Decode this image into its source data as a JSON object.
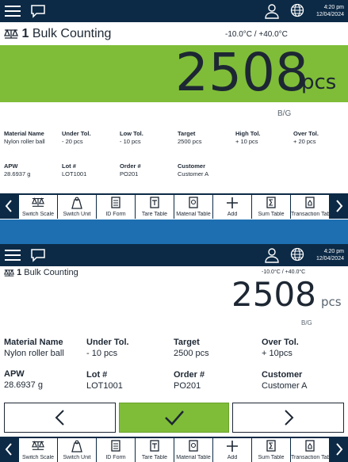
{
  "status": {
    "time": "4:20 pm",
    "date": "12/04/2024"
  },
  "screen1": {
    "scale_no": "1",
    "app_name": "Bulk Counting",
    "range": "-10.0°C / +40.0°C",
    "weight": "2508",
    "unit": "pcs",
    "mode": "B/G",
    "fields": [
      {
        "label": "Material Name",
        "value": "Nylon roller ball"
      },
      {
        "label": "Under Tol.",
        "value": "- 20 pcs"
      },
      {
        "label": "Low Tol.",
        "value": "- 10 pcs"
      },
      {
        "label": "Target",
        "value": "2500 pcs"
      },
      {
        "label": "High Tol.",
        "value": "+ 10 pcs"
      },
      {
        "label": "Over Tol.",
        "value": "+ 20 pcs"
      },
      {
        "label": "APW",
        "value": "28.6937 g"
      },
      {
        "label": "Lot #",
        "value": "LOT1001"
      },
      {
        "label": "Order #",
        "value": "PO201"
      },
      {
        "label": "Customer",
        "value": "Customer A"
      }
    ]
  },
  "screen2": {
    "scale_no": "1",
    "app_name": "Bulk Counting",
    "range": "-10.0°C / +40.0°C",
    "weight": "2508",
    "unit": "pcs",
    "mode": "B/G",
    "fields": [
      {
        "label": "Material Name",
        "value": "Nylon roller ball"
      },
      {
        "label": "Under Tol.",
        "value": "- 10 pcs"
      },
      {
        "label": "Target",
        "value": "2500 pcs"
      },
      {
        "label": "Over Tol.",
        "value": "+ 10pcs"
      },
      {
        "label": "APW",
        "value": "28.6937 g"
      },
      {
        "label": "Lot #",
        "value": "LOT1001"
      },
      {
        "label": "Order #",
        "value": "PO201"
      },
      {
        "label": "Customer",
        "value": "Customer A"
      }
    ]
  },
  "softkeys": [
    {
      "label": "Switch Scale",
      "icon": "balance-icon"
    },
    {
      "label": "Switch Unit",
      "icon": "weight-icon"
    },
    {
      "label": "ID Form",
      "icon": "form-icon"
    },
    {
      "label": "Tare Table",
      "icon": "tare-icon"
    },
    {
      "label": "Material Table",
      "icon": "material-icon"
    },
    {
      "label": "Add",
      "icon": "plus-icon"
    },
    {
      "label": "Sum Table",
      "icon": "sum-icon"
    },
    {
      "label": "Transaction Table",
      "icon": "transaction-icon"
    }
  ],
  "colors": {
    "accent_green": "#7fbd38",
    "bar_navy": "#0c2a46",
    "blue": "#1e6fb1"
  }
}
